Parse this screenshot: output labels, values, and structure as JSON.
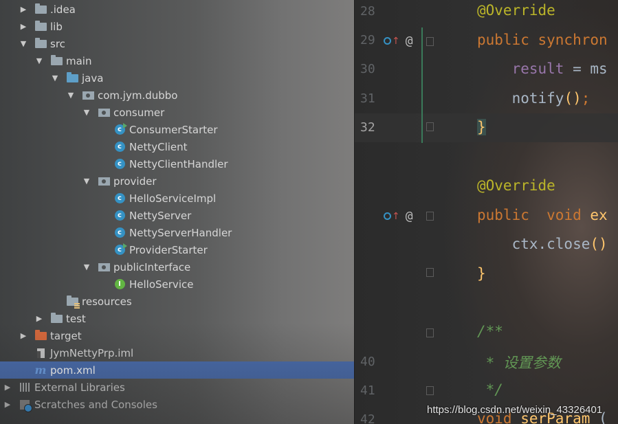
{
  "tree": {
    "items": [
      {
        "label": ".idea",
        "indent": 0,
        "expand": "collapsed",
        "icon": "folder"
      },
      {
        "label": "lib",
        "indent": 0,
        "expand": "collapsed",
        "icon": "folder"
      },
      {
        "label": "src",
        "indent": 0,
        "expand": "expanded",
        "icon": "folder"
      },
      {
        "label": "main",
        "indent": 1,
        "expand": "expanded",
        "icon": "folder"
      },
      {
        "label": "java",
        "indent": 2,
        "expand": "expanded",
        "icon": "source-folder"
      },
      {
        "label": "com.jym.dubbo",
        "indent": 3,
        "expand": "expanded",
        "icon": "package"
      },
      {
        "label": "consumer",
        "indent": 4,
        "expand": "expanded",
        "icon": "package"
      },
      {
        "label": "ConsumerStarter",
        "indent": 5,
        "expand": "none",
        "icon": "class-runnable"
      },
      {
        "label": "NettyClient",
        "indent": 5,
        "expand": "none",
        "icon": "class"
      },
      {
        "label": "NettyClientHandler",
        "indent": 5,
        "expand": "none",
        "icon": "class"
      },
      {
        "label": "provider",
        "indent": 4,
        "expand": "expanded",
        "icon": "package"
      },
      {
        "label": "HelloServiceImpl",
        "indent": 5,
        "expand": "none",
        "icon": "class"
      },
      {
        "label": "NettyServer",
        "indent": 5,
        "expand": "none",
        "icon": "class"
      },
      {
        "label": "NettyServerHandler",
        "indent": 5,
        "expand": "none",
        "icon": "class"
      },
      {
        "label": "ProviderStarter",
        "indent": 5,
        "expand": "none",
        "icon": "class-runnable"
      },
      {
        "label": "publicInterface",
        "indent": 4,
        "expand": "expanded",
        "icon": "package"
      },
      {
        "label": "HelloService",
        "indent": 5,
        "expand": "none",
        "icon": "interface"
      },
      {
        "label": "resources",
        "indent": 2,
        "expand": "none",
        "icon": "resources-folder"
      },
      {
        "label": "test",
        "indent": 1,
        "expand": "collapsed",
        "icon": "folder"
      },
      {
        "label": "target",
        "indent": 0,
        "expand": "collapsed",
        "icon": "excluded-folder"
      },
      {
        "label": "JymNettyPrp.iml",
        "indent": 0,
        "expand": "none",
        "icon": "module-file"
      },
      {
        "label": "pom.xml",
        "indent": 0,
        "expand": "none",
        "icon": "maven-file",
        "selected": true
      },
      {
        "label": "External Libraries",
        "indent": -1,
        "expand": "collapsed",
        "icon": "libraries"
      },
      {
        "label": "Scratches and Consoles",
        "indent": -1,
        "expand": "collapsed",
        "icon": "scratches"
      }
    ]
  },
  "editor": {
    "line_numbers": [
      "28",
      "29",
      "30",
      "31",
      "32",
      "",
      "",
      "",
      "",
      "",
      "",
      "",
      "",
      "40",
      "41",
      "42"
    ],
    "current_line": "32",
    "markers": {
      "override_icon": "override-icon",
      "at_icon_text": "@"
    },
    "code": {
      "l28": "@Override",
      "l29_kw": "public",
      "l29_rest": " synchron",
      "l30_field": "result",
      "l30_rest": " = ms",
      "l31_call": "notify",
      "l31_paren": "()",
      "l31_semi": ";",
      "l32_brace": "}",
      "l34": "@Override",
      "l35_kw1": "public",
      "l35_mid": "  ",
      "l35_kw2": "void",
      "l35_rest": " ex",
      "l36_text": "ctx.close",
      "l36_paren": "()",
      "l37_brace": "}",
      "l39": "/**",
      "l40_star": " * ",
      "l40_text": "设置参数",
      "l41": " */",
      "l42_kw": "void",
      "l42_name": " serParam",
      "l42_paren": " ("
    }
  },
  "watermark": "https://blog.csdn.net/weixin_43326401"
}
